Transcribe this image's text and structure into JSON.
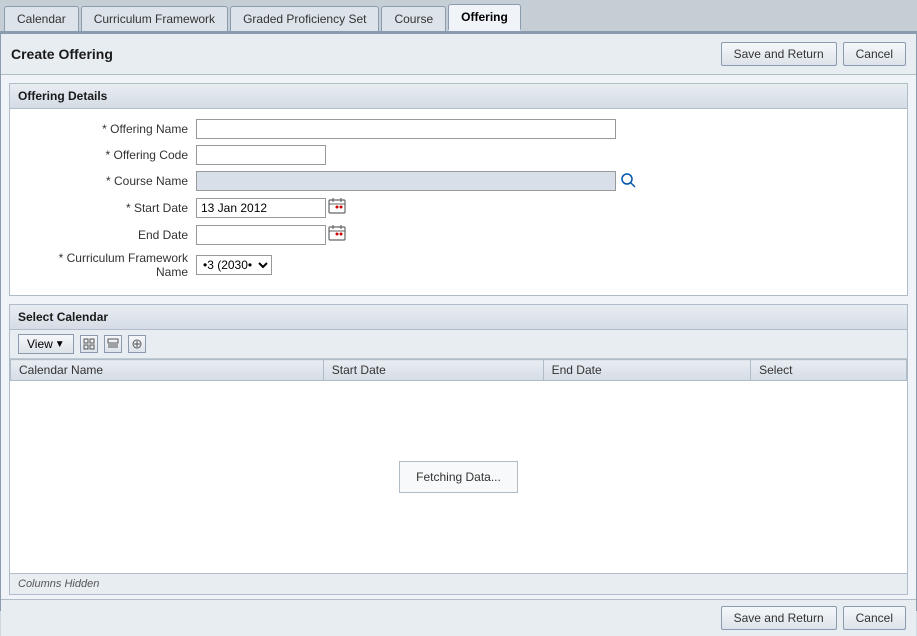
{
  "tabs": [
    {
      "id": "calendar",
      "label": "Calendar",
      "active": false
    },
    {
      "id": "curriculum-framework",
      "label": "Curriculum Framework",
      "active": false
    },
    {
      "id": "graded-proficiency-set",
      "label": "Graded Proficiency Set",
      "active": false
    },
    {
      "id": "course",
      "label": "Course",
      "active": false
    },
    {
      "id": "offering",
      "label": "Offering",
      "active": true
    }
  ],
  "header": {
    "title": "Create Offering",
    "save_return_label": "Save and Return",
    "cancel_label": "Cancel"
  },
  "offering_details": {
    "section_title": "Offering Details",
    "fields": {
      "offering_name_label": "* Offering Name",
      "offering_code_label": "* Offering Code",
      "course_name_label": "* Course Name",
      "start_date_label": "* Start Date",
      "end_date_label": "End Date",
      "curriculum_framework_label": "* Curriculum Framework Name",
      "start_date_value": "13 Jan 2012",
      "curriculum_framework_value": "•3 (2030•"
    }
  },
  "calendar_section": {
    "section_title": "Select Calendar",
    "toolbar": {
      "view_label": "View",
      "icon1": "≡",
      "icon2": "⊟",
      "icon3": "🔍"
    },
    "table": {
      "columns": [
        "Calendar Name",
        "Start Date",
        "End Date",
        "Select"
      ]
    },
    "fetching_message": "Fetching Data...",
    "columns_hidden_label": "Columns Hidden"
  },
  "bottom": {
    "save_return_label": "Save and Return",
    "cancel_label": "Cancel"
  }
}
